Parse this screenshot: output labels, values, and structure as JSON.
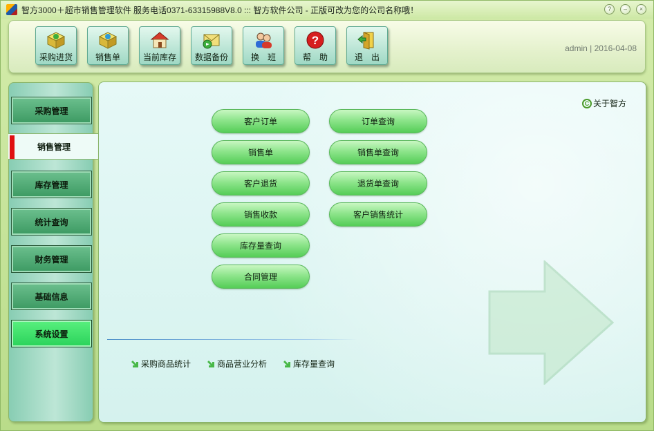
{
  "title": "智方3000＋超市销售管理软件   服务电话0371-63315988V8.0 ::: 智方软件公司 - 正版可改为您的公司名称哦！",
  "window_controls": [
    "?",
    "–",
    "×"
  ],
  "toolbar": {
    "buttons": [
      {
        "label": "采购进货",
        "icon": "purchase-box-icon"
      },
      {
        "label": "销售单",
        "icon": "sales-box-icon"
      },
      {
        "label": "当前库存",
        "icon": "house-icon"
      },
      {
        "label": "数据备份",
        "icon": "backup-envelope-icon"
      },
      {
        "label": "换　班",
        "icon": "users-icon"
      },
      {
        "label": "帮　助",
        "icon": "help-icon"
      },
      {
        "label": "退　出",
        "icon": "exit-door-icon"
      }
    ],
    "user": "admin",
    "separator": "|",
    "date": "2016-04-08"
  },
  "sidebar": {
    "items": [
      {
        "label": "采购管理"
      },
      {
        "label": "销售管理",
        "active": true
      },
      {
        "label": "库存管理"
      },
      {
        "label": "统计查询"
      },
      {
        "label": "财务管理"
      },
      {
        "label": "基础信息"
      },
      {
        "label": "系统设置"
      }
    ]
  },
  "main": {
    "about": "关于智方",
    "about_icon": "copyright-icon",
    "function_buttons": [
      "客户订单",
      "订单查询",
      "销售单",
      "销售单查询",
      "客户退货",
      "退货单查询",
      "销售收款",
      "客户销售统计",
      "库存量查询",
      "合同管理"
    ],
    "quick_links": [
      "采购商品统计",
      "商品营业分析",
      "库存量查询"
    ]
  },
  "colors": {
    "accent_green": "#55cd57",
    "active_marker": "#e01010",
    "sidebar_button": "#3c9a62",
    "settings_button": "#2ad25a"
  }
}
